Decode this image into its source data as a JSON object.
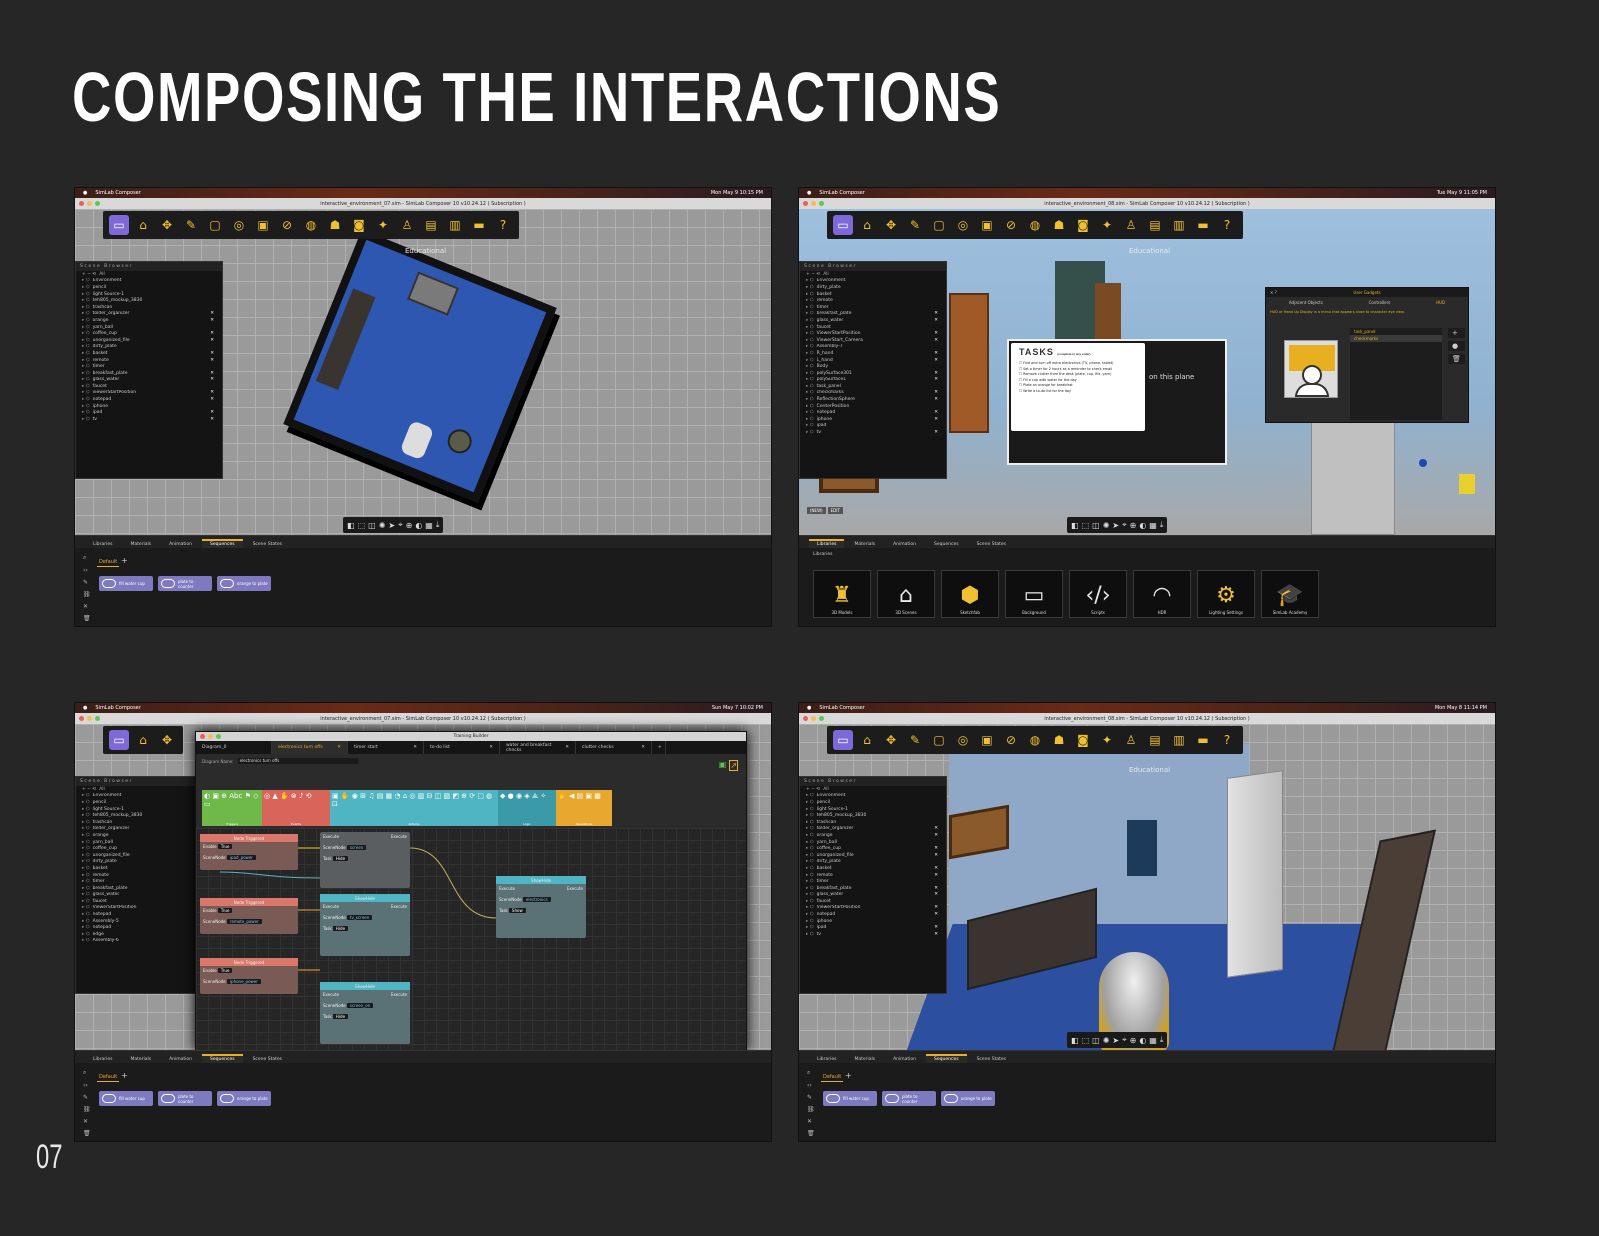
{
  "page": {
    "title": "COMPOSING THE INTERACTIONS",
    "number": "07"
  },
  "colors": {
    "background": "#262626",
    "accent_yellow": "#e8b020",
    "active_purple": "#7d6ad8"
  },
  "app": {
    "name": "SimLab Composer",
    "toolbar_icons": [
      "vr-icon",
      "scene-icon",
      "transform-icon",
      "edit-icon",
      "frame-icon",
      "animation-icon",
      "render-icon",
      "material-icon",
      "globe-icon",
      "cat-icon",
      "360-icon",
      "magic-icon",
      "person-icon",
      "video-icon",
      "panel-icon",
      "headset-icon",
      "help-icon"
    ],
    "view_label": "Educational",
    "bottom_tabs": [
      "Libraries",
      "Materials",
      "Animation",
      "Sequences",
      "Scene States"
    ],
    "scene_browser_title": "Scene Browser",
    "filter_all": "All"
  },
  "screens": [
    {
      "mac_left": "SimLab Composer",
      "mac_right": "Mon May 9  10:15 PM",
      "window_title": "interactive_environment_07.sim - SimLab Composer 10 v10.24.12 ( Subscription )",
      "browser_items": [
        "Environment",
        "pencil",
        "light Source-1",
        "teh805_mockup_3830",
        "trashcan",
        "tolder_organizer",
        "orange",
        "yarn_ball",
        "coffee_cup",
        "unorganized_file",
        "dirty_plate",
        "basket",
        "remote",
        "timer",
        "breakfast_plate",
        "glass_water",
        "faucet",
        "viewerStartPosition",
        "notepad",
        "iphone",
        "ipad",
        "tv"
      ],
      "seq_tab": "Default",
      "sequences": [
        "fill water cup",
        "plate to counter",
        "orange to plate"
      ]
    },
    {
      "mac_left": "SimLab Composer",
      "mac_right": "Tue May 9  11:05 PM",
      "window_title": "interactive_environment_08.sim - SimLab Composer 10 v10.24.12 ( Subscription )",
      "browser_items": [
        "Environment",
        "dirty_plate",
        "basket",
        "remote",
        "timer",
        "breakfast_plate",
        "glass_water",
        "faucet",
        "ViewerStartPosition",
        "ViewerStart_Camera",
        "Assembly-7",
        "R_hand",
        "L_hand",
        "Body",
        "polySurface301",
        "polySurface1",
        "task_panel",
        "checkmarks",
        "ReflectionSphere",
        "CenterPosition",
        "notepad",
        "iphone",
        "ipad",
        "tv"
      ],
      "plane_text": "on this plane",
      "tasks": {
        "title": "TASKS",
        "subtitle": "(complete in any order)",
        "items": [
          "Find and turn off extra electronics (TV, phone, tablet)",
          "Set a timer for 2 hours as a reminder to check email",
          "Remove clutter from the desk (plate, cup, file, yarn)",
          "Fill a cup with water for the day",
          "Plate an orange for breakfast",
          "Write a to-do list for the day"
        ]
      },
      "gadgets": {
        "title": "User Gadgets",
        "tabs": [
          "Adjacent Objects",
          "Controllers",
          "HUD"
        ],
        "description": "HUD or Head Up Display is a menu that appears close to character eye view.",
        "list": [
          "task_panel",
          "checkmarks"
        ]
      },
      "libraries_tab": "Libraries",
      "libraries": [
        {
          "icon": "chair-icon",
          "label": "3D Models"
        },
        {
          "icon": "room-icon",
          "label": "3D Scenes"
        },
        {
          "icon": "sketchfab-icon",
          "label": "Sketchfab"
        },
        {
          "icon": "background-icon",
          "label": "Background"
        },
        {
          "icon": "script-icon",
          "label": "Scripts"
        },
        {
          "icon": "hdr-icon",
          "label": "HDR"
        },
        {
          "icon": "lighting-icon",
          "label": "Lighting Settings"
        },
        {
          "icon": "academy-icon",
          "label": "SimLab Academy"
        }
      ],
      "overlay_buttons": [
        "(NEW)",
        "EDIT"
      ]
    },
    {
      "mac_left": "SimLab Composer",
      "mac_right": "Sun May 7  10:02 PM",
      "window_title": "interactive_environment_07.sim - SimLab Composer 10 v10.24.12 ( Subscription )",
      "browser_items": [
        "Environment",
        "pencil",
        "light Source-1",
        "teh805_mockup_3830",
        "trashcan",
        "tolder_organizer",
        "orange",
        "yarn_ball",
        "coffee_cup",
        "unorganized_file",
        "dirty_plate",
        "basket",
        "remote",
        "timer",
        "breakfast_plate",
        "glass_water",
        "faucet",
        "ViewerStartPosition",
        "notepad",
        "Assembly-5",
        "notepad",
        "edge",
        "Assembly-6"
      ],
      "diagram": {
        "window_title": "Training Builder",
        "tabs": [
          "Diagram_0",
          "electronics turn offs",
          "timer start",
          "to-do list",
          "water and breakfast checks",
          "clutter checks"
        ],
        "name_label": "Diagram Name:",
        "name_value": "electronics turn offs",
        "palette_groups": [
          "Triggers",
          "Events",
          "Actions",
          "Logic",
          "Operations"
        ],
        "trigger_nodes": [
          {
            "title": "Node Triggered",
            "enable": "True",
            "scene_node": "ipad_power"
          },
          {
            "title": "Node Triggered",
            "enable": "True",
            "scene_node": "remote_power"
          },
          {
            "title": "Node Triggered",
            "enable": "True",
            "scene_node": "iphone_power"
          }
        ],
        "action_nodes": [
          {
            "title": "",
            "scene_node": "screen",
            "task": "Hide"
          },
          {
            "title": "ShowHide",
            "scene_node": "tv_screen",
            "task": "Hide"
          },
          {
            "title": "ShowHide",
            "scene_node": "screen_on",
            "task": "Hide"
          },
          {
            "title": "ShowHide",
            "scene_node": "electronics",
            "task": "Show"
          }
        ],
        "ports": {
          "execute": "Execute",
          "scene_node": "SceneNode",
          "task": "Task",
          "enable": "Enable"
        }
      },
      "seq_tab": "Default",
      "sequences": [
        "fill water cup",
        "plate to counter",
        "orange to plate"
      ]
    },
    {
      "mac_left": "SimLab Composer",
      "mac_right": "Mon May 8  11:14 PM",
      "window_title": "interactive_environment_08.sim - SimLab Composer 10 v10.24.12 ( Subscription )",
      "browser_items": [
        "Environment",
        "pencil",
        "light Source-1",
        "teh805_mockup_3830",
        "trashcan",
        "tolder_organizer",
        "orange",
        "yarn_ball",
        "coffee_cup",
        "unorganized_file",
        "dirty_plate",
        "basket",
        "remote",
        "timer",
        "breakfast_plate",
        "glass_water",
        "faucet",
        "ViewerStartPosition",
        "notepad",
        "iphone",
        "ipad",
        "tv"
      ],
      "seq_tab": "Default",
      "sequences": [
        "fill water cup",
        "plate to counter",
        "orange to plate"
      ]
    }
  ]
}
